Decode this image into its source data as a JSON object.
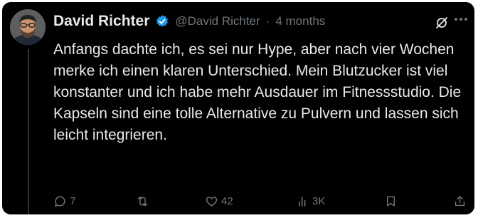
{
  "post": {
    "author_name": "David Richter",
    "author_handle": "@David Richter",
    "separator": "·",
    "time": "4 months",
    "body": "Anfangs dachte ich, es sei nur Hype, aber nach vier Wochen merke ich einen klaren Unterschied. Mein Blutzucker ist viel konstanter und ich habe mehr Ausdauer im Fitnessstudio. Die Kapseln sind eine tolle Alternative zu Pulvern und lassen sich leicht integrieren."
  },
  "actions": {
    "reply_count": "7",
    "repost_count": "",
    "like_count": "42",
    "views_count": "3K"
  },
  "colors": {
    "background": "#000000",
    "text_primary": "#e7e9ea",
    "text_secondary": "#71767b",
    "verified": "#1d9bf0"
  },
  "icons": [
    "verified-badge-icon",
    "grok-icon",
    "more-icon",
    "reply-icon",
    "repost-icon",
    "like-icon",
    "views-icon",
    "bookmark-icon",
    "share-icon"
  ]
}
